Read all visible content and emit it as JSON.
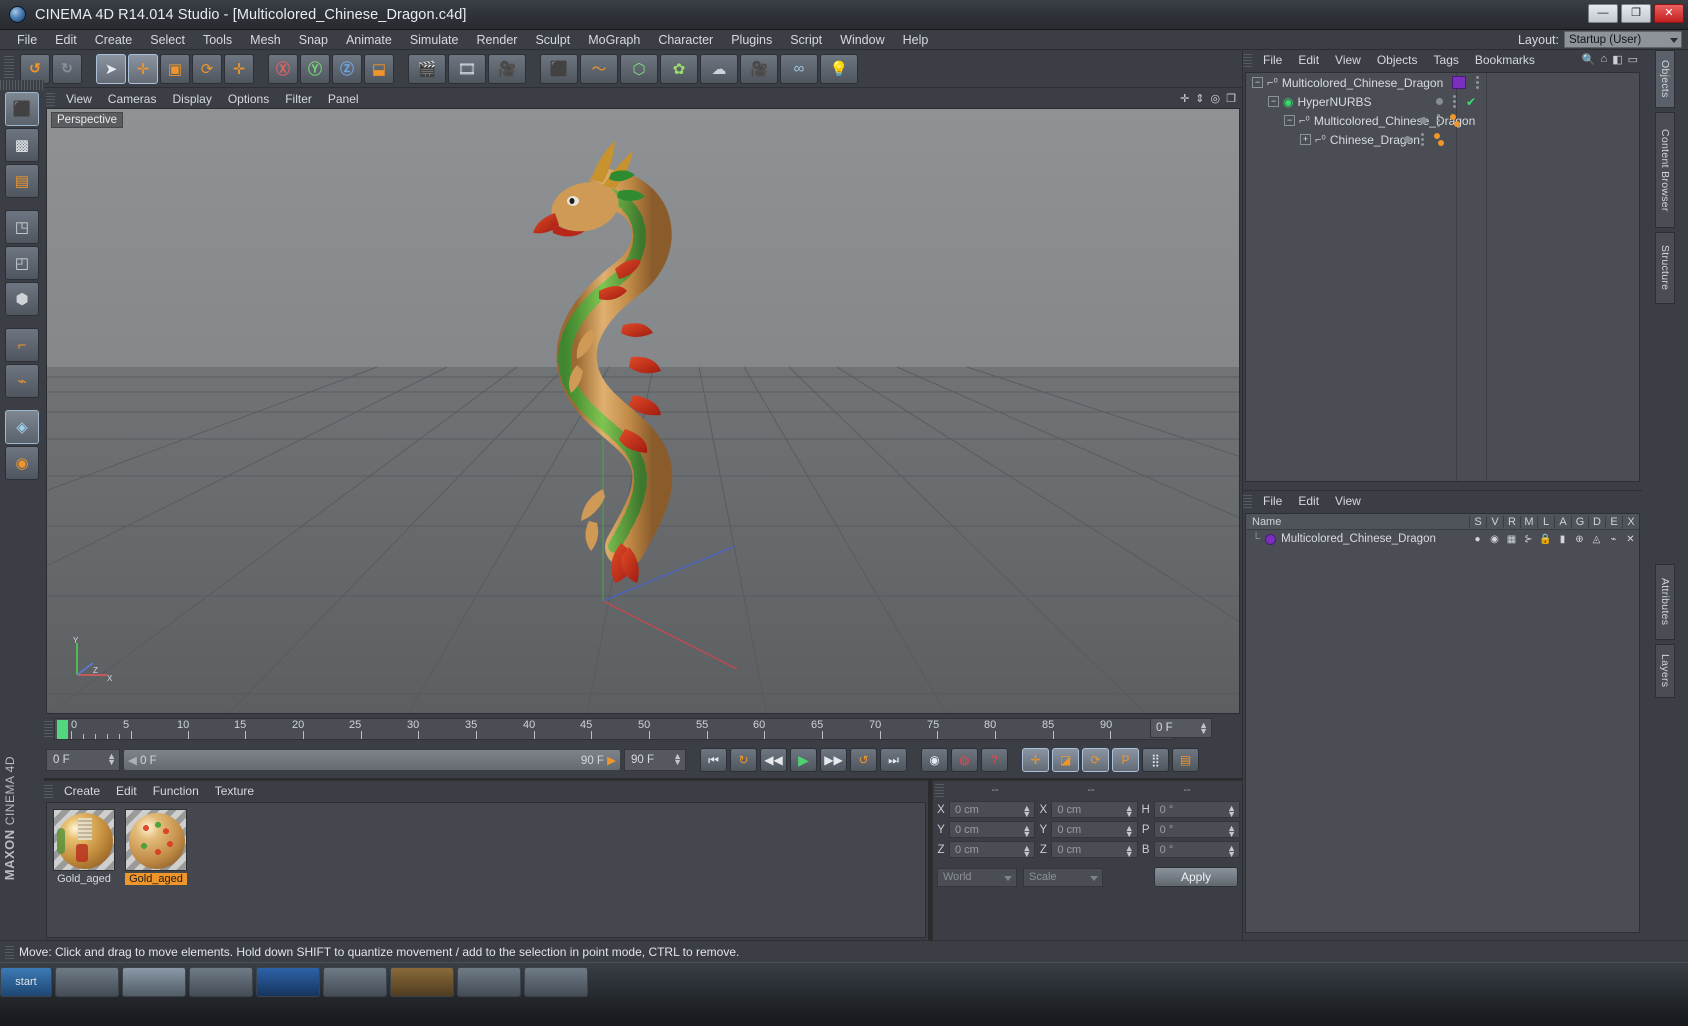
{
  "window": {
    "title": "CINEMA 4D R14.014 Studio - [Multicolored_Chinese_Dragon.c4d]",
    "logo_icon": "cinema4d-logo-icon",
    "minimize_label": "—",
    "maximize_label": "❐",
    "close_label": "✕"
  },
  "menubar": {
    "items": [
      {
        "label": "File"
      },
      {
        "label": "Edit"
      },
      {
        "label": "Create"
      },
      {
        "label": "Select"
      },
      {
        "label": "Tools"
      },
      {
        "label": "Mesh"
      },
      {
        "label": "Snap"
      },
      {
        "label": "Animate"
      },
      {
        "label": "Simulate"
      },
      {
        "label": "Render"
      },
      {
        "label": "Sculpt"
      },
      {
        "label": "MoGraph"
      },
      {
        "label": "Character"
      },
      {
        "label": "Plugins"
      },
      {
        "label": "Script"
      },
      {
        "label": "Window"
      },
      {
        "label": "Help"
      }
    ],
    "layout_label": "Layout:",
    "layout_value": "Startup (User)"
  },
  "command_toolbar": {
    "buttons": [
      {
        "name": "undo-button",
        "glyph": "↺"
      },
      {
        "name": "redo-button",
        "glyph": "↻"
      },
      {
        "name": "live-selection-tool",
        "glyph": "➤",
        "selected": true
      },
      {
        "name": "move-tool",
        "glyph": "✛",
        "selected": true
      },
      {
        "name": "scale-tool",
        "glyph": "▣"
      },
      {
        "name": "rotate-tool",
        "glyph": "⟳"
      },
      {
        "name": "free-transform-tool",
        "glyph": "✛"
      },
      {
        "name": "lock-x-axis-button",
        "glyph": "X"
      },
      {
        "name": "lock-y-axis-button",
        "glyph": "Y"
      },
      {
        "name": "lock-z-axis-button",
        "glyph": "Z"
      },
      {
        "name": "world-object-coordinate-button",
        "glyph": "⬓"
      },
      {
        "name": "render-view-button",
        "glyph": "🎬"
      },
      {
        "name": "render-region-button",
        "glyph": "🎞"
      },
      {
        "name": "render-settings-button",
        "glyph": "🎥"
      },
      {
        "name": "add-cube-object-button",
        "glyph": "⬛"
      },
      {
        "name": "add-spline-button",
        "glyph": "〜"
      },
      {
        "name": "add-generator-button",
        "glyph": "⬡"
      },
      {
        "name": "add-deformer-button",
        "glyph": "✿"
      },
      {
        "name": "add-scene-object-button",
        "glyph": "☁"
      },
      {
        "name": "add-camera-button",
        "glyph": "🎥"
      },
      {
        "name": "add-tag-button",
        "glyph": "∞"
      },
      {
        "name": "add-light-button",
        "glyph": "💡"
      }
    ]
  },
  "left_toolbar": {
    "buttons": [
      {
        "name": "model-mode-button",
        "glyph": "⬛"
      },
      {
        "name": "texture-mode-button",
        "glyph": "▩"
      },
      {
        "name": "workplane-mode-button",
        "glyph": "▤"
      },
      {
        "name": "point-mode-button",
        "glyph": "◳"
      },
      {
        "name": "edge-mode-button",
        "glyph": "◰"
      },
      {
        "name": "polygon-mode-button",
        "glyph": "⬢"
      },
      {
        "name": "axis-mode-button",
        "glyph": "⌐"
      },
      {
        "name": "enable-deformer-button",
        "glyph": "⌁"
      },
      {
        "name": "viewport-solo-button",
        "glyph": "◈"
      },
      {
        "name": "snap-mode-button",
        "glyph": "◉"
      }
    ],
    "brand": "MAXON",
    "brand_sub": "CINEMA 4D"
  },
  "viewport": {
    "menus": [
      {
        "label": "View"
      },
      {
        "label": "Cameras"
      },
      {
        "label": "Display"
      },
      {
        "label": "Options"
      },
      {
        "label": "Filter"
      },
      {
        "label": "Panel"
      }
    ],
    "view_label": "Perspective",
    "axis_labels": {
      "y": "Y",
      "x": "X",
      "z": "Z"
    },
    "corner_icons": [
      {
        "name": "pan-viewport-icon",
        "glyph": "✛"
      },
      {
        "name": "dolly-viewport-icon",
        "glyph": "⇕"
      },
      {
        "name": "orbit-viewport-icon",
        "glyph": "◎"
      },
      {
        "name": "maximize-viewport-icon",
        "glyph": "❐"
      }
    ],
    "scene_object": "Multicolored_Chinese_Dragon"
  },
  "timeline": {
    "ticks": [
      {
        "label": "0",
        "value": 0
      },
      {
        "label": "5",
        "value": 5
      },
      {
        "label": "10",
        "value": 10
      },
      {
        "label": "15",
        "value": 15
      },
      {
        "label": "20",
        "value": 20
      },
      {
        "label": "25",
        "value": 25
      },
      {
        "label": "30",
        "value": 30
      },
      {
        "label": "35",
        "value": 35
      },
      {
        "label": "40",
        "value": 40
      },
      {
        "label": "45",
        "value": 45
      },
      {
        "label": "50",
        "value": 50
      },
      {
        "label": "55",
        "value": 55
      },
      {
        "label": "60",
        "value": 60
      },
      {
        "label": "65",
        "value": 65
      },
      {
        "label": "70",
        "value": 70
      },
      {
        "label": "75",
        "value": 75
      },
      {
        "label": "80",
        "value": 80
      },
      {
        "label": "85",
        "value": 85
      },
      {
        "label": "90",
        "value": 90
      }
    ],
    "playhead_frame": 0,
    "ruler_frame_field": "0 F",
    "current_frame_field": "0 F",
    "range_start": "0 F",
    "range_end": "90 F",
    "end_frame_field": "90 F",
    "transport": [
      {
        "name": "go-to-start-button",
        "glyph": "⏮"
      },
      {
        "name": "play-backwards-loop-button",
        "glyph": "↻"
      },
      {
        "name": "go-to-previous-frame-button",
        "glyph": "◀◀"
      },
      {
        "name": "play-forwards-button",
        "glyph": "▶"
      },
      {
        "name": "go-to-next-frame-button",
        "glyph": "▶▶"
      },
      {
        "name": "play-forwards-loop-button",
        "glyph": "↺"
      },
      {
        "name": "go-to-end-button",
        "glyph": "⏭"
      }
    ],
    "record_tools": [
      {
        "name": "record-active-objects-button",
        "glyph": "◉"
      },
      {
        "name": "autokeying-button",
        "glyph": "◍"
      },
      {
        "name": "keyframe-selection-button",
        "glyph": "?"
      }
    ],
    "key_tools": [
      {
        "name": "position-key-button",
        "glyph": "✛"
      },
      {
        "name": "scale-key-button",
        "glyph": "◪"
      },
      {
        "name": "rotation-key-button",
        "glyph": "⟳"
      },
      {
        "name": "parameter-key-button",
        "glyph": "P"
      },
      {
        "name": "point-level-animation-button",
        "glyph": "⣿"
      },
      {
        "name": "animation-layers-button",
        "glyph": "▤"
      }
    ]
  },
  "material_manager": {
    "menus": [
      {
        "label": "Create"
      },
      {
        "label": "Edit"
      },
      {
        "label": "Function"
      },
      {
        "label": "Texture"
      }
    ],
    "materials": [
      {
        "name": "Gold_aged",
        "selected": false
      },
      {
        "name": "Gold_aged",
        "selected": true
      }
    ]
  },
  "coordinates": {
    "col_headers": [
      "--",
      "--",
      "--"
    ],
    "rows": [
      {
        "lbl1": "X",
        "val1": "0 cm",
        "lbl2": "X",
        "val2": "0 cm",
        "lbl3": "H",
        "val3": "0 °"
      },
      {
        "lbl1": "Y",
        "val1": "0 cm",
        "lbl2": "Y",
        "val2": "0 cm",
        "lbl3": "P",
        "val3": "0 °"
      },
      {
        "lbl1": "Z",
        "val1": "0 cm",
        "lbl2": "Z",
        "val2": "0 cm",
        "lbl3": "B",
        "val3": "0 °"
      }
    ],
    "system_select": "World",
    "mode_select": "Scale",
    "apply_label": "Apply"
  },
  "object_manager": {
    "menus": [
      {
        "label": "File"
      },
      {
        "label": "Edit"
      },
      {
        "label": "View"
      },
      {
        "label": "Objects"
      },
      {
        "label": "Tags"
      },
      {
        "label": "Bookmarks"
      }
    ],
    "header_icons": [
      {
        "name": "search-icon",
        "glyph": "🔍"
      },
      {
        "name": "home-icon",
        "glyph": "⌂"
      },
      {
        "name": "collapse-icon",
        "glyph": "◧"
      },
      {
        "name": "expand-icon",
        "glyph": "▭"
      }
    ],
    "tree": [
      {
        "label": "Multicolored_Chinese_Dragon",
        "depth": 0,
        "icon": "null-object-icon",
        "expander": "−",
        "tag": "purple-layer-tag"
      },
      {
        "label": "HyperNURBS",
        "depth": 1,
        "icon": "hypernurbs-icon",
        "expander": "−",
        "tag": "green-check-tag"
      },
      {
        "label": "Multicolored_Chinese_Dragon",
        "depth": 2,
        "icon": "null-object-icon",
        "expander": "−",
        "tag": "orange-material-tags"
      },
      {
        "label": "Chinese_Dragon",
        "depth": 3,
        "icon": "null-object-icon",
        "expander": "+",
        "tag": "orange-material-tags"
      }
    ]
  },
  "layer_manager": {
    "menus": [
      {
        "label": "File"
      },
      {
        "label": "Edit"
      },
      {
        "label": "View"
      }
    ],
    "columns": [
      "Name",
      "S",
      "V",
      "R",
      "M",
      "L",
      "A",
      "G",
      "D",
      "E",
      "X"
    ],
    "rows": [
      {
        "name": "Multicolored_Chinese_Dragon",
        "cells": [
          "●",
          "◉",
          "▦",
          "⊱",
          "🔒",
          "▮",
          "⊕",
          "◬",
          "⌁",
          "✕"
        ]
      }
    ]
  },
  "right_tabs": [
    {
      "label": "Objects",
      "active": true
    },
    {
      "label": "Content Browser",
      "active": false
    },
    {
      "label": "Structure",
      "active": false
    },
    {
      "label": "Attributes",
      "active": false
    },
    {
      "label": "Layers",
      "active": false
    }
  ],
  "statusbar": {
    "text": "Move: Click and drag to move elements. Hold down SHIFT to quantize movement / add to the selection in point mode, CTRL to remove."
  },
  "taskbar": {
    "start_label": "start",
    "items": [
      {
        "label": ""
      },
      {
        "label": ""
      },
      {
        "label": ""
      },
      {
        "label": ""
      },
      {
        "label": ""
      },
      {
        "label": ""
      },
      {
        "label": ""
      },
      {
        "label": ""
      }
    ]
  },
  "colors": {
    "accent_orange": "#f0952a",
    "accent_green": "#3ddd6d",
    "tag_purple": "#7a2fbf",
    "panel_bg": "#3b3f45",
    "field_bg": "#4a4e54"
  }
}
